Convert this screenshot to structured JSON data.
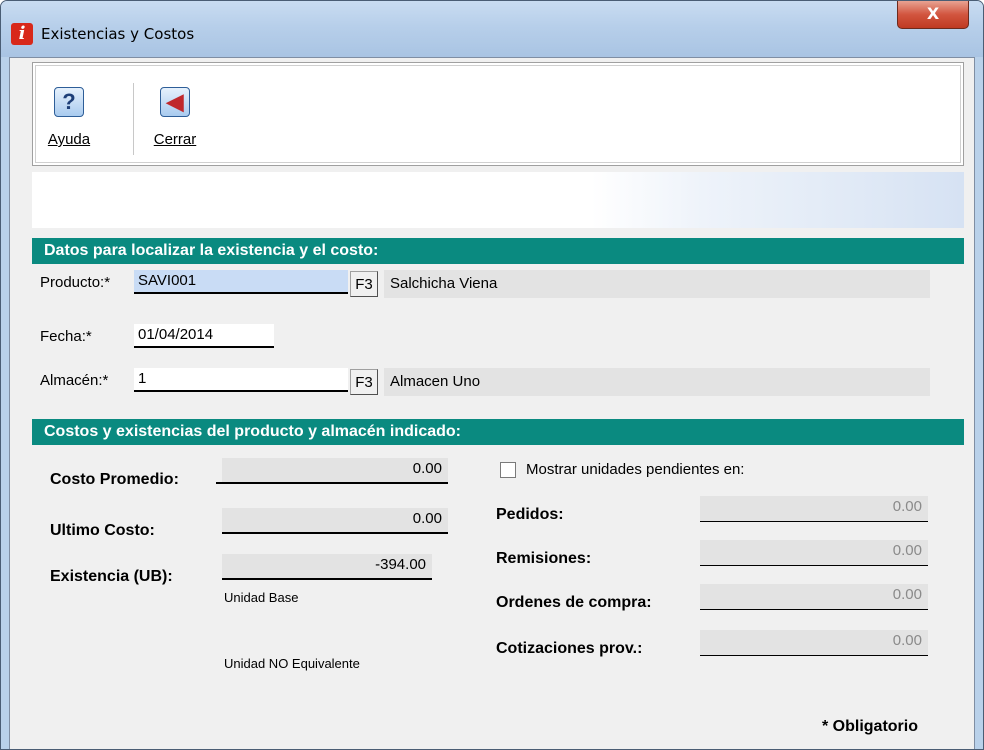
{
  "window": {
    "title": "Existencias y Costos",
    "app_icon_glyph": "i",
    "close_glyph": "X"
  },
  "toolbar": {
    "help_label": "Ayuda",
    "close_label": "Cerrar",
    "help_icon": "question-icon",
    "close_icon": "exit-door-icon"
  },
  "section1": {
    "header": "Datos para localizar la existencia y el costo:",
    "product_label": "Producto:*",
    "product_value": "SAVI001",
    "product_f3": "F3",
    "product_desc": "Salchicha Viena",
    "date_label": "Fecha:*",
    "date_value": "01/04/2014",
    "warehouse_label": "Almacén:*",
    "warehouse_value": "1",
    "warehouse_f3": "F3",
    "warehouse_desc": "Almacen Uno"
  },
  "section2": {
    "header": "Costos  y existencias del producto y almacén indicado:",
    "avg_cost_label": "Costo Promedio:",
    "avg_cost_value": "0.00",
    "last_cost_label": "Ultimo Costo:",
    "last_cost_value": "0.00",
    "stock_label": "Existencia (UB):",
    "stock_value": "-394.00",
    "base_unit_label": "Unidad Base",
    "non_equiv_label": "Unidad NO Equivalente",
    "show_pending_label": "Mostrar unidades pendientes en:",
    "orders_label": "Pedidos:",
    "orders_value": "0.00",
    "remissions_label": "Remisiones:",
    "remissions_value": "0.00",
    "purchase_orders_label": "Ordenes de compra:",
    "purchase_orders_value": "0.00",
    "quotes_label": "Cotizaciones prov.:",
    "quotes_value": "0.00"
  },
  "footer": {
    "required_note": "* Obligatorio"
  },
  "colors": {
    "section_header_bg": "#0a8a80",
    "selected_input_bg": "#c9dcf5",
    "close_button": "#c03a22"
  }
}
